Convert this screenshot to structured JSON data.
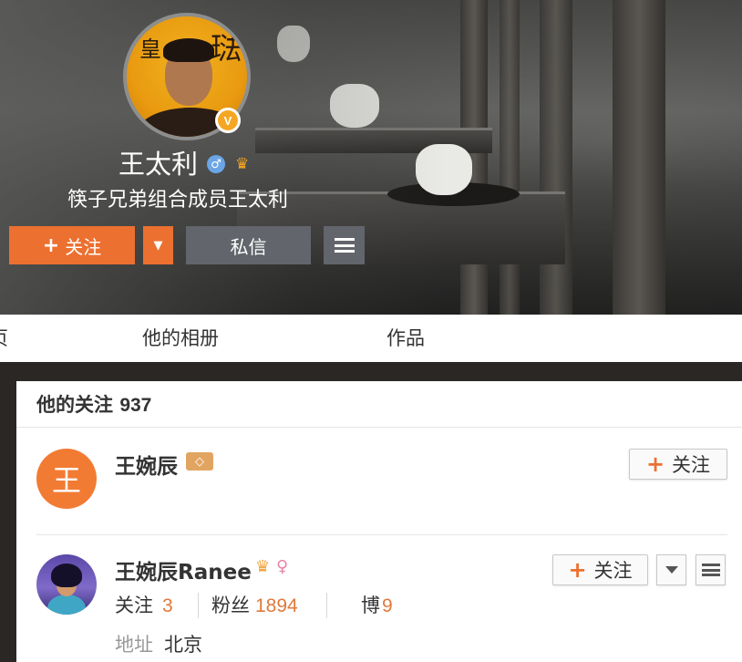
{
  "profile": {
    "name": "王太利",
    "description": "筷子兄弟组合成员王太利",
    "verified_badge": "V",
    "gender_icon": "male-icon",
    "member_icon": "crown-icon",
    "avatar_glyphs": [
      "皇",
      "琺"
    ]
  },
  "actions": {
    "follow_label": "关注",
    "message_label": "私信",
    "follow_plus": "+",
    "dropdown_glyph": "▼"
  },
  "tabs": [
    {
      "label": "页"
    },
    {
      "label": "他的相册"
    },
    {
      "label": "作品"
    }
  ],
  "following": {
    "title": "他的关注",
    "count": "937",
    "items": [
      {
        "name": "王婉辰",
        "avatar_text": "王",
        "badge_icon": "diamond-icon",
        "follow_label": "关注"
      },
      {
        "name": "王婉辰Ranee",
        "badge_icons": [
          "crown-icon",
          "female-icon"
        ],
        "follow_label": "关注",
        "stats": [
          {
            "label": "关注",
            "value": "3"
          },
          {
            "label": "粉丝",
            "value": "1894"
          },
          {
            "label": "博",
            "value": "9"
          }
        ],
        "location_label": "地址",
        "location_value": "北京"
      }
    ]
  },
  "colors": {
    "accent": "#ec7030",
    "dark_button": "#62656b",
    "stat_value": "#e0793a"
  }
}
